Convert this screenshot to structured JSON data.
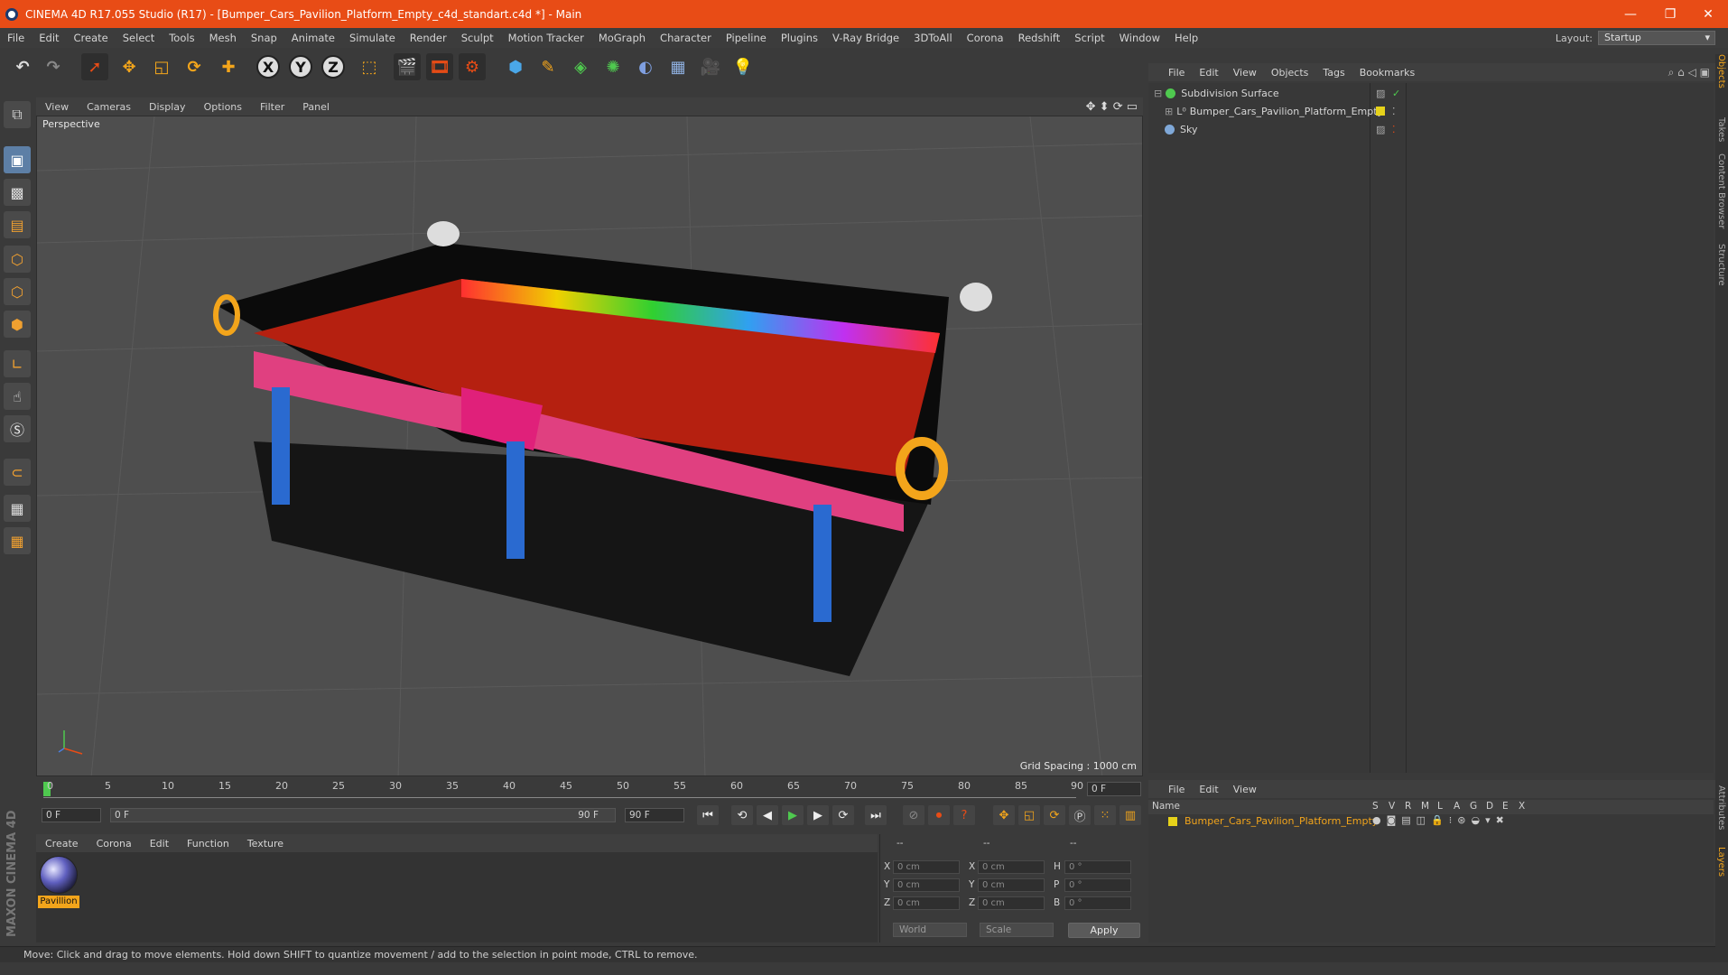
{
  "window": {
    "title": "CINEMA 4D R17.055 Studio (R17) - [Bumper_Cars_Pavilion_Platform_Empty_c4d_standart.c4d *] - Main",
    "minimize": "—",
    "maximize": "❐",
    "close": "✕"
  },
  "menu": {
    "items": [
      "File",
      "Edit",
      "Create",
      "Select",
      "Tools",
      "Mesh",
      "Snap",
      "Animate",
      "Simulate",
      "Render",
      "Sculpt",
      "Motion Tracker",
      "MoGraph",
      "Character",
      "Pipeline",
      "Plugins",
      "V-Ray Bridge",
      "3DToAll",
      "Corona",
      "Redshift",
      "Script",
      "Window",
      "Help"
    ],
    "layout_label": "Layout:",
    "layout_value": "Startup"
  },
  "toolbar": {
    "axis_x": "X",
    "axis_y": "Y",
    "axis_z": "Z"
  },
  "viewport": {
    "menu": [
      "View",
      "Cameras",
      "Display",
      "Options",
      "Filter",
      "Panel"
    ],
    "label": "Perspective",
    "grid_spacing": "Grid Spacing : 1000 cm"
  },
  "timeline": {
    "ticks": [
      "0",
      "5",
      "10",
      "15",
      "20",
      "25",
      "30",
      "35",
      "40",
      "45",
      "50",
      "55",
      "60",
      "65",
      "70",
      "75",
      "80",
      "85",
      "90"
    ],
    "current_frame": "0 F",
    "start_frame": "0 F",
    "range_start": "0 F",
    "range_end": "90 F",
    "end_frame": "90 F"
  },
  "materials": {
    "menu": [
      "Create",
      "Corona",
      "Edit",
      "Function",
      "Texture"
    ],
    "items": [
      {
        "name": "Pavillion"
      }
    ]
  },
  "coordinates": {
    "header": [
      "--",
      "--",
      "--"
    ],
    "rows": [
      {
        "a": "X",
        "av": "0 cm",
        "b": "X",
        "bv": "0 cm",
        "c": "H",
        "cv": "0 °"
      },
      {
        "a": "Y",
        "av": "0 cm",
        "b": "Y",
        "bv": "0 cm",
        "c": "P",
        "cv": "0 °"
      },
      {
        "a": "Z",
        "av": "0 cm",
        "b": "Z",
        "bv": "0 cm",
        "c": "B",
        "cv": "0 °"
      }
    ],
    "mode1": "World",
    "mode2": "Scale",
    "apply": "Apply"
  },
  "status": {
    "text": "Move: Click and drag to move elements. Hold down SHIFT to quantize movement / add to the selection in point mode, CTRL to remove."
  },
  "object_manager": {
    "menu": [
      "File",
      "Edit",
      "View",
      "Objects",
      "Tags",
      "Bookmarks"
    ],
    "objects": [
      {
        "name": "Subdivision Surface",
        "color": "#4fc94f"
      },
      {
        "name": "Bumper_Cars_Pavilion_Platform_Empty",
        "color": "#d0d0d0"
      },
      {
        "name": "Sky",
        "color": "#7fa8d8"
      }
    ]
  },
  "layer_manager": {
    "menu": [
      "File",
      "Edit",
      "View"
    ],
    "columns": [
      "Name",
      "S",
      "V",
      "R",
      "M",
      "L",
      "A",
      "G",
      "D",
      "E",
      "X"
    ],
    "layers": [
      {
        "name": "Bumper_Cars_Pavilion_Platform_Empty"
      }
    ]
  },
  "right_tabs": [
    "Objects",
    "Takes",
    "Content Browser",
    "Structure",
    "Attributes",
    "Layers"
  ],
  "branding": {
    "maxon": "MAXON CINEMA 4D"
  },
  "colors": {
    "accent": "#e84c16",
    "highlight": "#f3a51b",
    "selected_tool": "#5d7fa6"
  }
}
